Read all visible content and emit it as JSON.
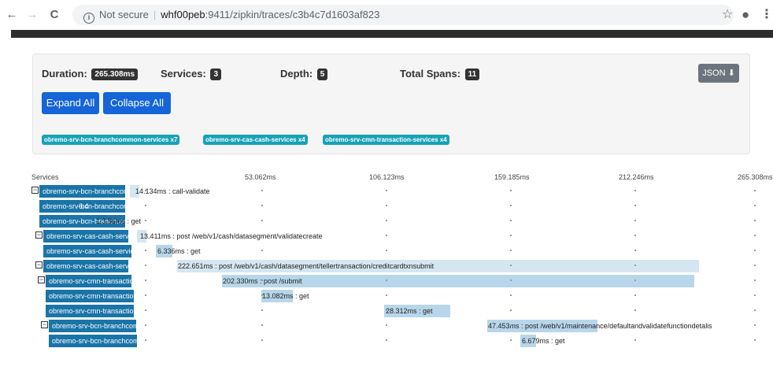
{
  "browser": {
    "back_icon": "←",
    "forward_icon": "→",
    "reload_icon": "C",
    "info_icon": "i",
    "not_secure": "Not secure",
    "separator": "|",
    "host": "whf00peb",
    "url_rest": ":9411/zipkin/traces/c3b4c7d1603af823",
    "star_icon": "☆",
    "account_icon": "●",
    "menu_icon": "⋮"
  },
  "summary": {
    "duration_label": "Duration:",
    "duration_value": "265.308ms",
    "services_label": "Services:",
    "services_value": "3",
    "depth_label": "Depth:",
    "depth_value": "5",
    "total_spans_label": "Total Spans:",
    "total_spans_value": "11",
    "json_label": "JSON",
    "download_icon": "⬇",
    "expand_all": "Expand All",
    "collapse_all": "Collapse All",
    "service_badges": [
      "obremo-srv-bcn-branchcommon-services x7",
      "obremo-srv-cas-cash-services x4",
      "obremo-srv-cmn-transaction-services x4"
    ]
  },
  "timeline": {
    "services_header": "Services",
    "ticks": [
      "53.062ms",
      "106.123ms",
      "159.185ms",
      "212.246ms",
      "265.308ms"
    ],
    "rows": [
      {
        "service": "obremo-srv-bcn-branchcommon-services",
        "toggle": "−",
        "span": "14.134ms : call-validate"
      },
      {
        "service": "obremo-srv-bcn-branchcommon-services",
        "toggle": "",
        "span": "6.4"
      },
      {
        "service": "obremo-srv-bcn-branchcommon-services",
        "toggle": "",
        "span": "1.3.86ms : get"
      },
      {
        "service": "obremo-srv-cas-cash-services",
        "toggle": "−",
        "span": "13.411ms : post /web/v1/cash/datasegment/validatecreate"
      },
      {
        "service": "obremo-srv-cas-cash-services",
        "toggle": "",
        "span": "6.336ms : get"
      },
      {
        "service": "obremo-srv-cas-cash-services",
        "toggle": "−",
        "span": "222.651ms : post /web/v1/cash/datasegment/tellertransaction/creditcardtxnsubmit"
      },
      {
        "service": "obremo-srv-cmn-transaction-services",
        "toggle": "−",
        "span": "202.330ms : post /submit"
      },
      {
        "service": "obremo-srv-cmn-transaction-services",
        "toggle": "",
        "span": "13.082ms : get"
      },
      {
        "service": "obremo-srv-cmn-transaction-services",
        "toggle": "",
        "span": "28.312ms : get"
      },
      {
        "service": "obremo-srv-bcn-branchcommon-services",
        "toggle": "−",
        "span": "47.453ms : post /web/v1/maintenance/defaultandvalidatefunctiondetalis"
      },
      {
        "service": "obremo-srv-bcn-branchcommon-services",
        "toggle": "",
        "span": "6.679ms : get"
      }
    ]
  }
}
